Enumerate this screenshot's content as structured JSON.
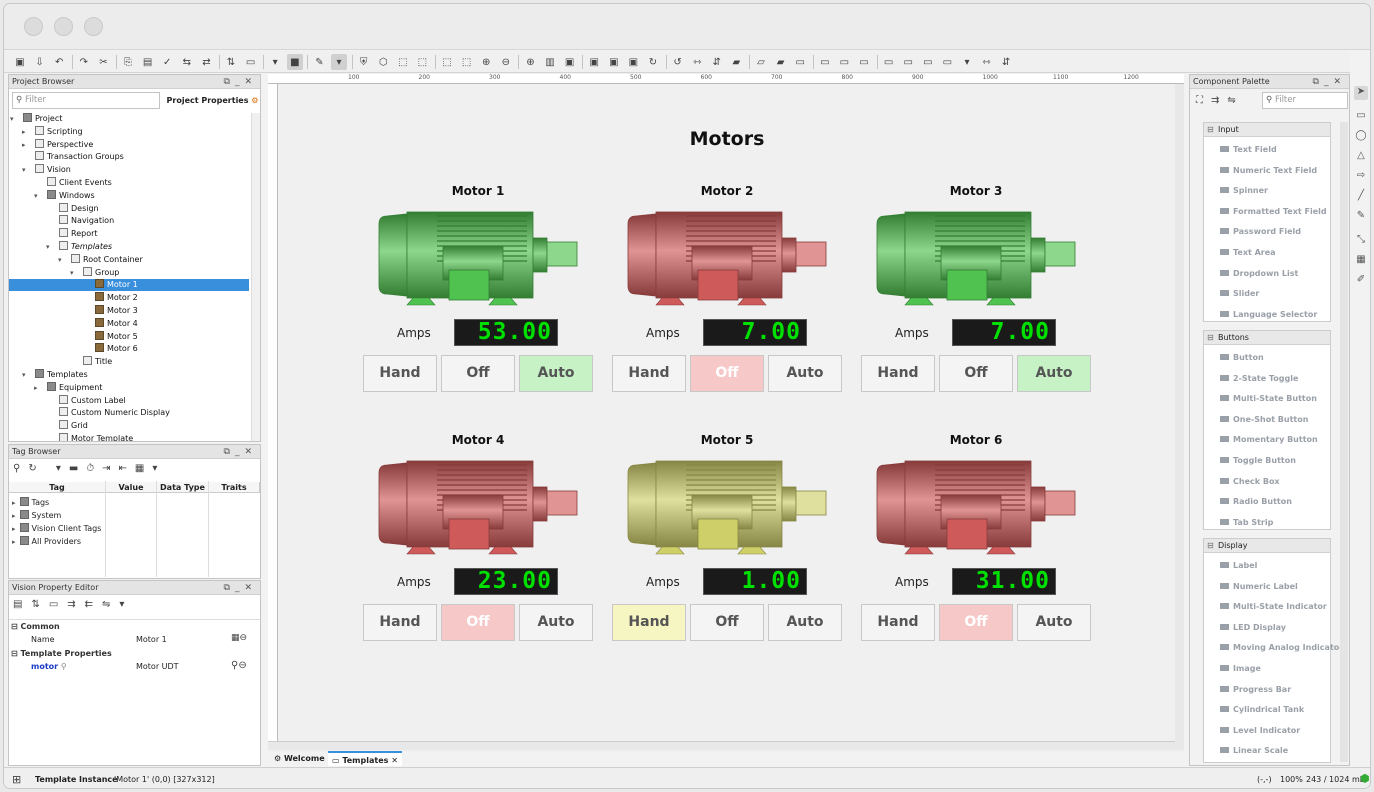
{
  "project_browser": {
    "title": "Project Browser",
    "filter_placeholder": "Filter",
    "properties_button": "Project Properties",
    "tree": [
      "Project",
      "Scripting",
      "Perspective",
      "Transaction Groups",
      "Vision",
      "Client Events",
      "Windows",
      "Design",
      "Navigation",
      "Report",
      "Templates",
      "Root Container",
      "Group",
      "Motor 1",
      "Motor 2",
      "Motor 3",
      "Motor 4",
      "Motor 5",
      "Motor 6",
      "Title",
      "Templates",
      "Equipment",
      "Custom Label",
      "Custom Numeric Display",
      "Grid",
      "Motor Template"
    ]
  },
  "tag_browser": {
    "title": "Tag Browser",
    "columns": [
      "Tag",
      "Value",
      "Data Type",
      "Traits"
    ],
    "rows": [
      "Tags",
      "System",
      "Vision Client Tags",
      "All Providers"
    ]
  },
  "property_editor": {
    "title": "Vision Property Editor",
    "common": "Common",
    "name_label": "Name",
    "name_value": "Motor 1",
    "template_props": "Template Properties",
    "motor_label": "motor",
    "motor_value": "Motor UDT"
  },
  "canvas": {
    "title": "Motors",
    "amps_label": "Amps",
    "hand": "Hand",
    "off": "Off",
    "auto": "Auto",
    "motors": [
      {
        "name": "Motor 1",
        "amps": "53.00",
        "color": "#4fc24f",
        "mode": "auto"
      },
      {
        "name": "Motor 2",
        "amps": "7.00",
        "color": "#cf5a5a",
        "mode": "off"
      },
      {
        "name": "Motor 3",
        "amps": "7.00",
        "color": "#4fc24f",
        "mode": "auto"
      },
      {
        "name": "Motor 4",
        "amps": "23.00",
        "color": "#cf5a5a",
        "mode": "off"
      },
      {
        "name": "Motor 5",
        "amps": "1.00",
        "color": "#cfcf6a",
        "mode": "hand"
      },
      {
        "name": "Motor 6",
        "amps": "31.00",
        "color": "#cf5a5a",
        "mode": "off"
      }
    ],
    "ruler_labels": [
      "100",
      "200",
      "300",
      "400",
      "500",
      "600",
      "700",
      "800",
      "900",
      "1000",
      "1100",
      "1200"
    ]
  },
  "tabs": {
    "welcome": "Welcome",
    "templates": "Templates"
  },
  "palette": {
    "title": "Component Palette",
    "filter_placeholder": "Filter",
    "sections": [
      {
        "name": "Input",
        "items": [
          "Text Field",
          "Numeric Text Field",
          "Spinner",
          "Formatted Text Field",
          "Password Field",
          "Text Area",
          "Dropdown List",
          "Slider",
          "Language Selector"
        ]
      },
      {
        "name": "Buttons",
        "items": [
          "Button",
          "2-State Toggle",
          "Multi-State Button",
          "One-Shot Button",
          "Momentary Button",
          "Toggle Button",
          "Check Box",
          "Radio Button",
          "Tab Strip"
        ]
      },
      {
        "name": "Display",
        "items": [
          "Label",
          "Numeric Label",
          "Multi-State Indicator",
          "LED Display",
          "Moving Analog Indicator",
          "Image",
          "Progress Bar",
          "Cylindrical Tank",
          "Level Indicator",
          "Linear Scale"
        ]
      }
    ]
  },
  "status": {
    "left": "Template Instance",
    "detail": "'Motor 1' (0,0) [327x312]",
    "coords": "(-,-)",
    "zoom": "100%",
    "memory": "243 / 1024 mb"
  }
}
